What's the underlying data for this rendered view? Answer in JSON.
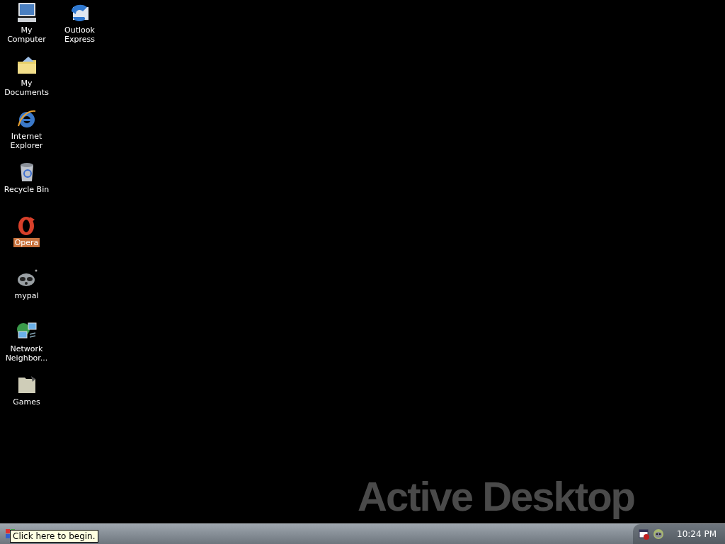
{
  "desktop_icons": [
    {
      "label": "My Computer",
      "selected": false
    },
    {
      "label": "My Documents",
      "selected": false
    },
    {
      "label": "Internet Explorer",
      "selected": false
    },
    {
      "label": "Recycle Bin",
      "selected": false
    },
    {
      "label": "Opera",
      "selected": true
    },
    {
      "label": "mypal",
      "selected": false
    },
    {
      "label": "Network Neighbor...",
      "selected": false
    },
    {
      "label": "Games",
      "selected": false
    },
    {
      "label": "Outlook Express",
      "selected": false
    }
  ],
  "wallpaper_logo": "Active Desktop",
  "tooltip": "Click here to begin.",
  "taskbar": {
    "clock": "10:24 PM"
  }
}
